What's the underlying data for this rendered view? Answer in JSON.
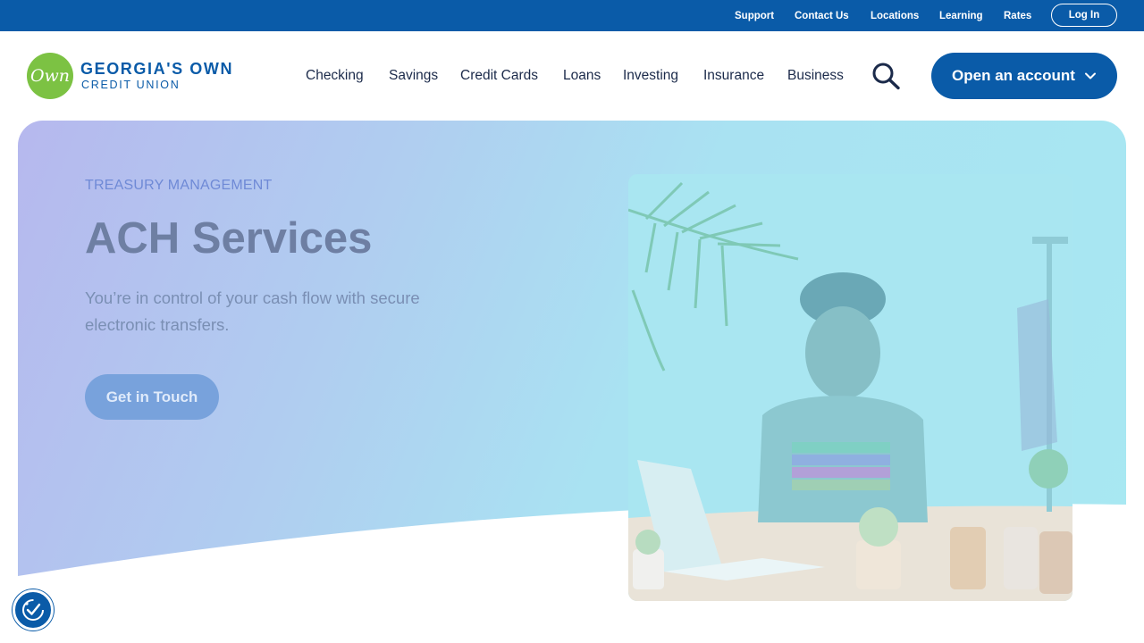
{
  "utility": {
    "links": [
      "Support",
      "Contact Us",
      "Locations",
      "Learning",
      "Rates"
    ],
    "login_label": "Log In"
  },
  "logo": {
    "mark_text": "Own",
    "line1": "GEORGIA'S OWN",
    "line2": "CREDIT UNION"
  },
  "nav": {
    "items": [
      "Checking",
      "Savings",
      "Credit Cards",
      "Loans",
      "Investing",
      "Insurance",
      "Business"
    ],
    "search_icon": "search-icon",
    "open_account_label": "Open an account"
  },
  "hero": {
    "eyebrow": "TREASURY MANAGEMENT",
    "title": "ACH Services",
    "body": "You’re in control of your cash flow with secure electronic transfers.",
    "cta_label": "Get in Touch"
  },
  "accessibility": {
    "icon": "accessibility-check-icon"
  },
  "colors": {
    "brand_blue": "#0a5ba8",
    "logo_green": "#7cc243",
    "nav_text": "#1b2a4a"
  }
}
